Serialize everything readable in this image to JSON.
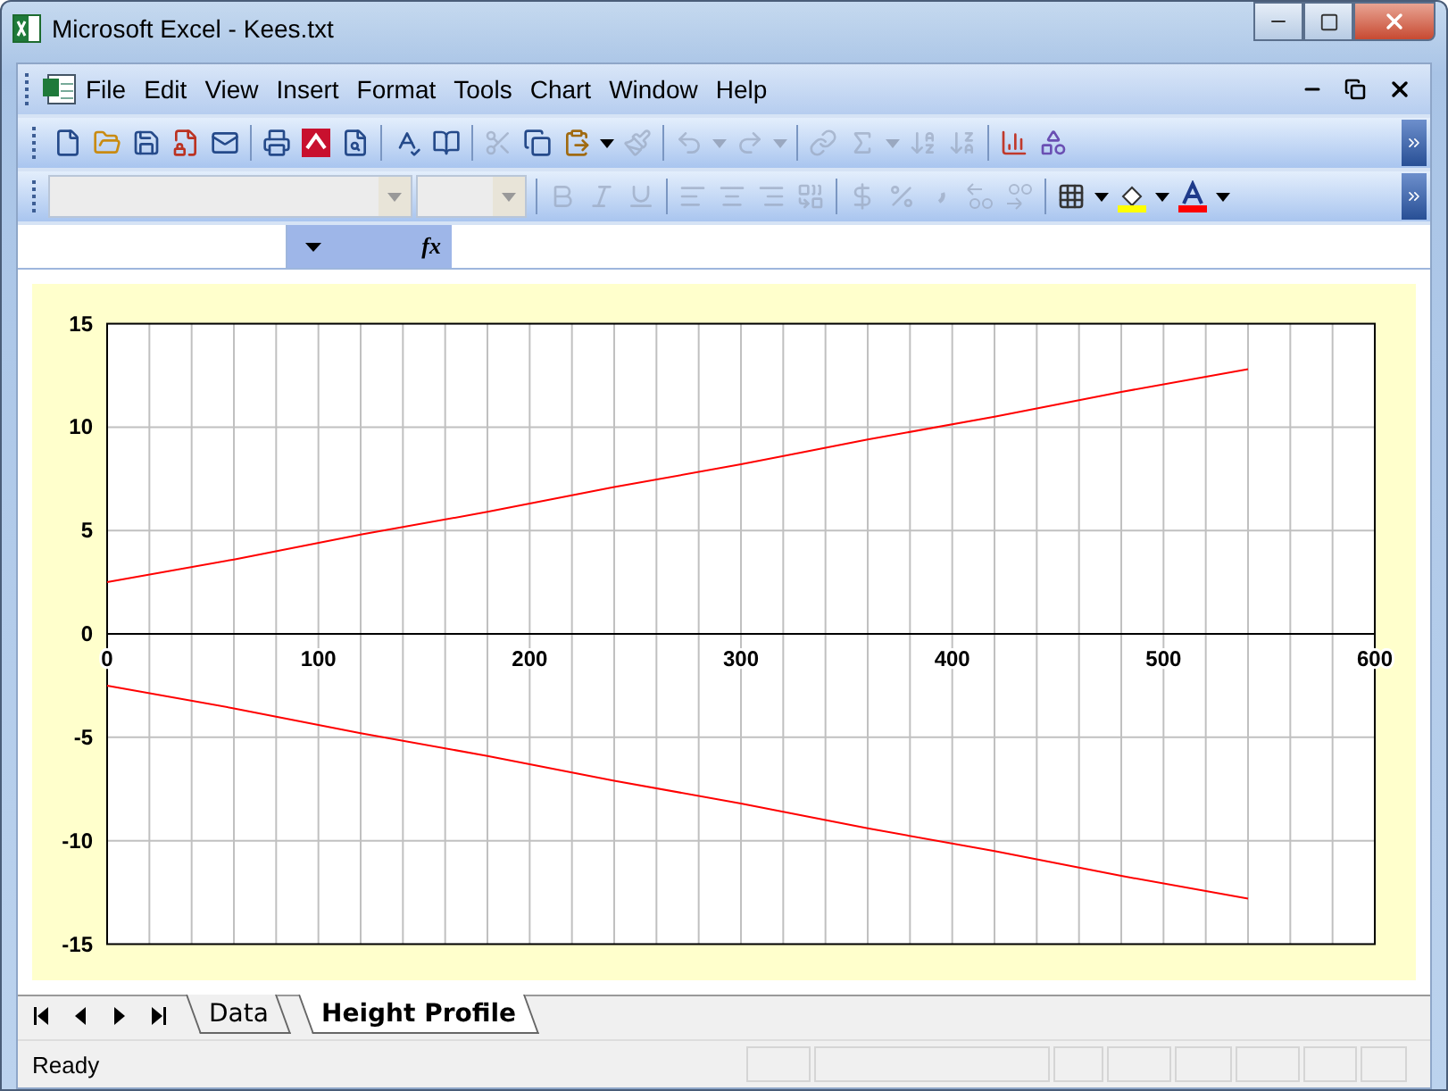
{
  "window": {
    "title": "Microsoft Excel - Kees.txt"
  },
  "menu": [
    "File",
    "Edit",
    "View",
    "Insert",
    "Format",
    "Tools",
    "Chart",
    "Window",
    "Help"
  ],
  "toolbar_standard": [
    {
      "kind": "new",
      "disabled": false
    },
    {
      "kind": "open",
      "disabled": false
    },
    {
      "kind": "save",
      "disabled": false
    },
    {
      "kind": "permission",
      "disabled": false
    },
    {
      "kind": "mail",
      "disabled": false
    },
    {
      "kind": "separator"
    },
    {
      "kind": "print",
      "disabled": false
    },
    {
      "kind": "pdf",
      "disabled": false
    },
    {
      "kind": "preview",
      "disabled": false
    },
    {
      "kind": "separator"
    },
    {
      "kind": "spelling",
      "disabled": false
    },
    {
      "kind": "research",
      "disabled": false
    },
    {
      "kind": "separator"
    },
    {
      "kind": "cut",
      "disabled": true
    },
    {
      "kind": "copy",
      "disabled": false
    },
    {
      "kind": "paste",
      "disabled": false
    },
    {
      "kind": "caret",
      "disabled": false
    },
    {
      "kind": "painter",
      "disabled": true
    },
    {
      "kind": "separator"
    },
    {
      "kind": "undo",
      "disabled": true
    },
    {
      "kind": "caret",
      "disabled": true
    },
    {
      "kind": "redo",
      "disabled": true
    },
    {
      "kind": "caret",
      "disabled": true
    },
    {
      "kind": "separator"
    },
    {
      "kind": "link",
      "disabled": true
    },
    {
      "kind": "sum",
      "disabled": true
    },
    {
      "kind": "caret",
      "disabled": true
    },
    {
      "kind": "sort-asc",
      "disabled": true
    },
    {
      "kind": "sort-desc",
      "disabled": true
    },
    {
      "kind": "separator"
    },
    {
      "kind": "chart",
      "disabled": false
    },
    {
      "kind": "drawing",
      "disabled": false
    }
  ],
  "toolbar_formatting": [
    {
      "kind": "font-field",
      "disabled": true
    },
    {
      "kind": "size-field",
      "disabled": true
    },
    {
      "kind": "separator"
    },
    {
      "kind": "bold",
      "disabled": true
    },
    {
      "kind": "italic",
      "disabled": true
    },
    {
      "kind": "underline",
      "disabled": true
    },
    {
      "kind": "separator"
    },
    {
      "kind": "align-left",
      "disabled": true
    },
    {
      "kind": "align-center",
      "disabled": true
    },
    {
      "kind": "align-right",
      "disabled": true
    },
    {
      "kind": "merge",
      "disabled": true
    },
    {
      "kind": "separator"
    },
    {
      "kind": "currency",
      "disabled": true
    },
    {
      "kind": "percent",
      "disabled": true
    },
    {
      "kind": "comma",
      "disabled": true
    },
    {
      "kind": "inc-decimal",
      "disabled": true
    },
    {
      "kind": "dec-decimal",
      "disabled": true
    },
    {
      "kind": "separator"
    },
    {
      "kind": "borders",
      "disabled": false
    },
    {
      "kind": "caret",
      "disabled": false
    },
    {
      "kind": "fill",
      "disabled": false
    },
    {
      "kind": "caret",
      "disabled": false
    },
    {
      "kind": "font-color",
      "disabled": false
    },
    {
      "kind": "caret",
      "disabled": false
    }
  ],
  "formula_bar": {
    "fx": "fx"
  },
  "chart_data": {
    "type": "line",
    "grid": true,
    "x": [
      0,
      60,
      120,
      180,
      240,
      300,
      360,
      420,
      480,
      540
    ],
    "series": [
      {
        "color": "#ff0000",
        "values": [
          2.5,
          3.6,
          4.8,
          5.9,
          7.1,
          8.2,
          9.4,
          10.5,
          11.7,
          12.8
        ]
      },
      {
        "color": "#ff0000",
        "values": [
          -2.5,
          -3.6,
          -4.8,
          -5.9,
          -7.1,
          -8.2,
          -9.4,
          -10.5,
          -11.7,
          -12.8
        ]
      }
    ],
    "xlim": [
      0,
      600
    ],
    "ylim": [
      -15,
      15
    ],
    "xticks": [
      0,
      100,
      200,
      300,
      400,
      500,
      600
    ],
    "yticks": [
      -15,
      -10,
      -5,
      0,
      5,
      10,
      15
    ]
  },
  "sheet_tabs": [
    {
      "label": "Data",
      "selected": false
    },
    {
      "label": "Height Profile",
      "selected": true
    }
  ],
  "status_bar": {
    "text": "Ready"
  }
}
